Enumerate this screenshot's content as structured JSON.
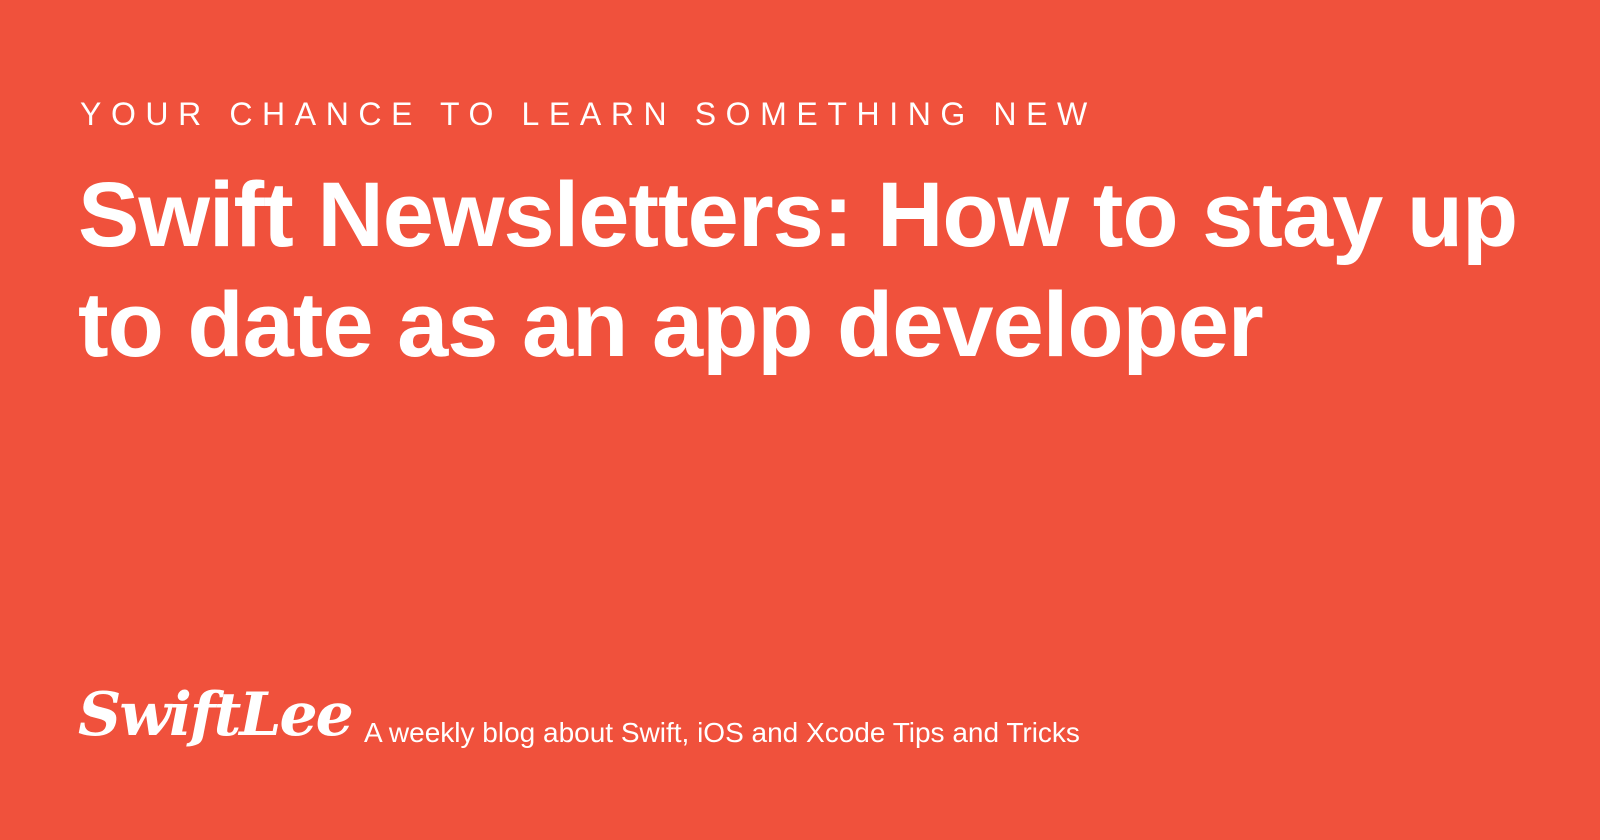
{
  "header": {
    "kicker": "YOUR CHANCE TO LEARN SOMETHING NEW",
    "title": "Swift Newsletters: How to stay up to date as an app developer"
  },
  "footer": {
    "logo_text": "SwiftLee",
    "tagline": "A weekly blog about Swift, iOS and Xcode Tips and Tricks"
  },
  "colors": {
    "background": "#F0513C",
    "text": "#FFFFFF"
  }
}
